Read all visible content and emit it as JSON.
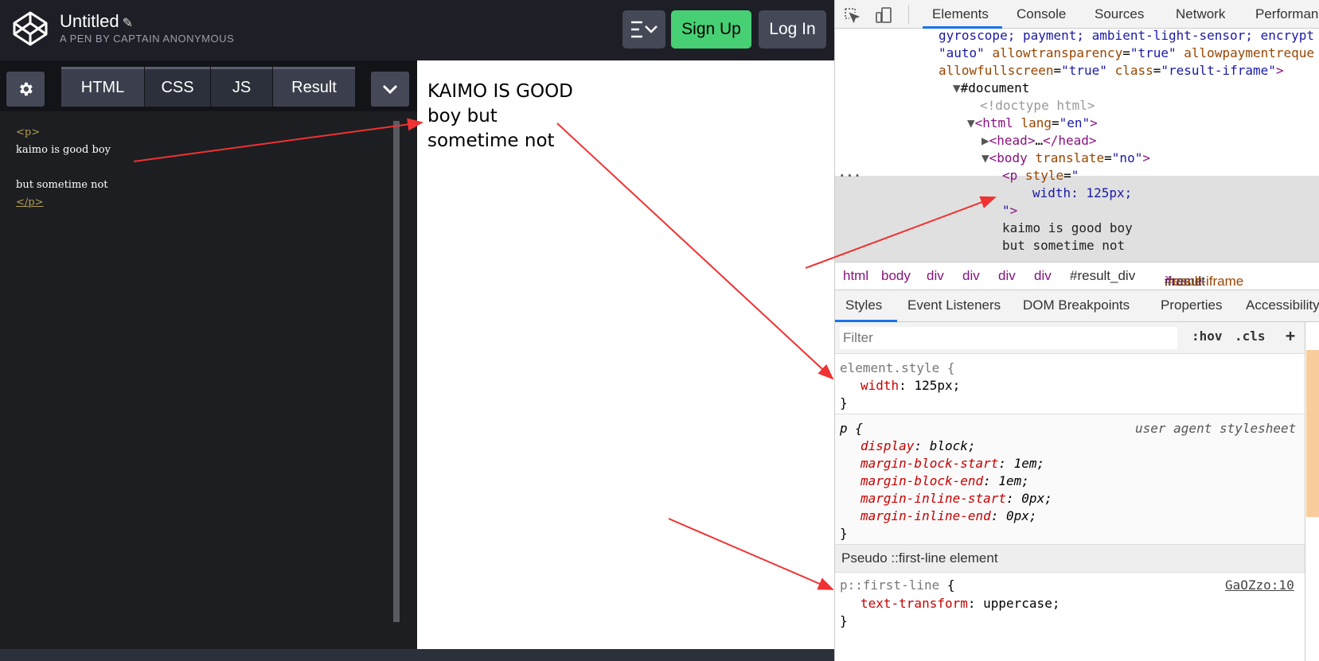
{
  "codepen": {
    "title": "Untitled",
    "subtitle": "A PEN BY CAPTAIN ANONYMOUS",
    "signup_label": "Sign Up",
    "login_label": "Log In",
    "tabs": [
      "HTML",
      "CSS",
      "JS",
      "Result"
    ],
    "code_lines": [
      "<p>",
      "kaimo is good boy",
      "",
      "but sometime not",
      "</p>"
    ],
    "result_text": "kaimo is good boy but sometime not"
  },
  "devtools": {
    "tabs": [
      "Elements",
      "Console",
      "Sources",
      "Network",
      "Performan"
    ],
    "dom": {
      "line1": "gyroscope; payment; ambient-light-sensor; encrypt",
      "line2_val1": "\"auto\"",
      "line2_attr": "allowtransparency",
      "line2_val2": "\"true\"",
      "line2_attr2": "allowpaymentreque",
      "line3_attr1": "allowfullscreen",
      "line3_val1": "\"true\"",
      "line3_attr2": "class",
      "line3_val2": "\"result-iframe\"",
      "document": "#document",
      "doctype": "<!doctype html>",
      "html_tag": "html",
      "html_lang_attr": "lang",
      "html_lang_val": "\"en\"",
      "head": "head",
      "head_ellipsis": "…",
      "body_tag": "body",
      "body_attr": "translate",
      "body_val": "\"no\"",
      "p_tag": "p",
      "p_attr": "style",
      "p_style_val": "width: 125px;",
      "text1": "kaimo is good boy",
      "text2": "but sometime not"
    },
    "breadcrumb": [
      "html",
      "body",
      "div",
      "div",
      "div",
      "div",
      "#result_div",
      "iframe",
      "#result",
      ".result-iframe"
    ],
    "sub_tabs": [
      "Styles",
      "Event Listeners",
      "DOM Breakpoints",
      "Properties",
      "Accessibility"
    ],
    "filter_placeholder": "Filter",
    "hov_label": ":hov",
    "cls_label": ".cls",
    "plus_label": "+",
    "element_style": {
      "selector": "element.style {",
      "prop": "width",
      "value": "125px;",
      "close": "}"
    },
    "p_rule": {
      "selector": "p {",
      "source": "user agent stylesheet",
      "decls": [
        {
          "prop": "display",
          "value": "block;"
        },
        {
          "prop": "margin-block-start",
          "value": "1em;"
        },
        {
          "prop": "margin-block-end",
          "value": "1em;"
        },
        {
          "prop": "margin-inline-start",
          "value": "0px;"
        },
        {
          "prop": "margin-inline-end",
          "value": "0px;"
        }
      ],
      "close": "}"
    },
    "pseudo_header": "Pseudo ::first-line element",
    "first_line_rule": {
      "selector": "p::first-line",
      "brace": "{",
      "source": "GaOZzo:10",
      "prop": "text-transform",
      "value": "uppercase;",
      "close": "}"
    }
  },
  "colors": {
    "signup_green": "#47cf73",
    "arrow_red": "#f03232",
    "selection_grey": "#e0e0e0",
    "tab_blue": "#1a73e8"
  }
}
